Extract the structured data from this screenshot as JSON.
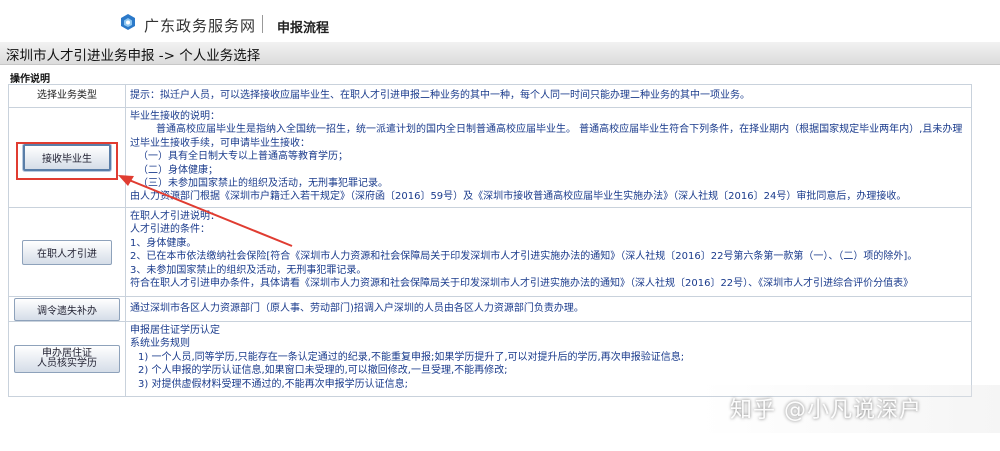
{
  "header": {
    "logo_icon": "gd-logo-icon",
    "site_name": "广东政务服务网",
    "page_name": "申报流程"
  },
  "title": "深圳市人才引进业务申报 -> 个人业务选择",
  "section_label": "操作说明",
  "table": {
    "header_left": "选择业务类型",
    "header_right": "提示：拟迁户人员，可以选择接收应届毕业生、在职人才引进申报二种业务的其中一种，每个人同一时间只能办理二种业务的其中一项业务。",
    "rows": [
      {
        "button": "接收毕业生",
        "lines": [
          "毕业生接收的说明：",
          "普通高校应届毕业生是指纳入全国统一招生，统一派遣计划的国内全日制普通高校应届毕业生。 普通高校应届毕业生符合下列条件，在择业期内（根据国家规定毕业两年内）,且未办理",
          "过毕业生接收手续，可申请毕业生接收：",
          "（一）具有全日制大专以上普通高等教育学历；",
          "（二）身体健康；",
          "（三）未参加国家禁止的组织及活动，无刑事犯罪记录。",
          "由人力资源部门根据《深圳市户籍迁入若干规定》（深府函〔2016〕59号）及《深圳市接收普通高校应届毕业生实施办法》（深人社规〔2016〕24号）审批同意后，办理接收。"
        ]
      },
      {
        "button": "在职人才引进",
        "lines": [
          "在职人才引进说明：",
          "人才引进的条件：",
          "1、身体健康。",
          "2、已在本市依法缴纳社会保险[符合《深圳市人力资源和社会保障局关于印发深圳市人才引进实施办法的通知》（深人社规〔2016〕22号第六条第一款第（一）、（二）项的除外]。",
          "3、未参加国家禁止的组织及活动，无刑事犯罪记录。",
          "符合在职人才引进申办条件，具体请看《深圳市人力资源和社会保障局关于印发深圳市人才引进实施办法的通知》（深人社规〔2016〕22号）、《深圳市人才引进综合评价分值表》"
        ]
      },
      {
        "button": "调令遗失补办",
        "lines": [
          "通过深圳市各区人力资源部门（原人事、劳动部门)招调入户深圳的人员由各区人力资源部门负责办理。"
        ]
      },
      {
        "button_line1": "申办居住证",
        "button_line2": "人员核实学历",
        "lines": [
          "申报居住证学历认定",
          "系统业务规则",
          "1) 一个人员,同等学历,只能存在一条认定通过的纪录,不能重复申报;如果学历提升了,可以对提升后的学历,再次申报验证信息;",
          "2) 个人申报的学历认证信息,如果窗口未受理的,可以撤回修改,一旦受理,不能再修改;",
          "3) 对提供虚假材料受理不通过的,不能再次申报学历认证信息;"
        ]
      }
    ]
  },
  "watermark": "知乎 @小凡说深户",
  "colors": {
    "annotation_arrow": "#e03c31",
    "red_text": "#c00000",
    "blue_text": "#1a3b8c"
  }
}
